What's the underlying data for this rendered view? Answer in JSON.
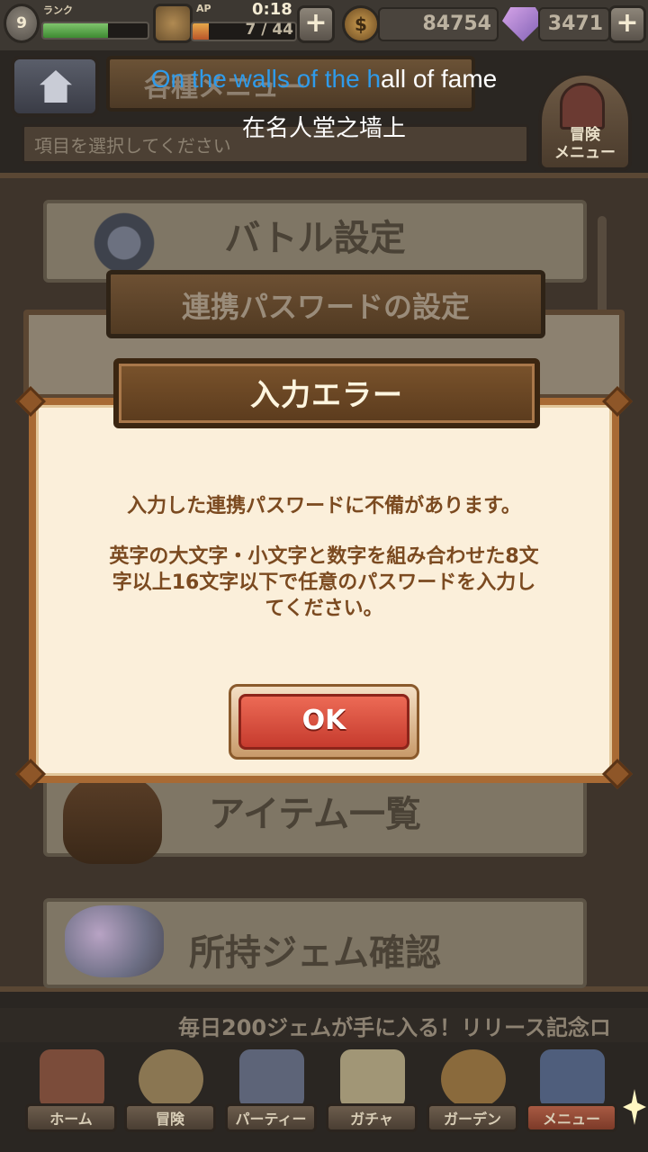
{
  "status_bar": {
    "rank_level": "9",
    "rank_label": "ランク",
    "rank_progress": 0.62,
    "ap_label": "AP",
    "ap_timer": "0:18",
    "ap_value": "7 / 44",
    "ap_progress": 0.16,
    "coins": "84754",
    "gems": "3471",
    "plus_symbol": "+"
  },
  "menu_header": {
    "title": "各種メニュー",
    "subtitle": "項目を選択してください",
    "adventure_menu_label": "冒険\nメニュー"
  },
  "menu_list": {
    "items": [
      {
        "label": "バトル設定"
      },
      {
        "label": "アイテム一覧"
      },
      {
        "label": "所持ジェム確認"
      }
    ]
  },
  "link_password_dialog": {
    "title": "連携パスワードの設定"
  },
  "error_dialog": {
    "title": "入力エラー",
    "message_line1": "入力した連携パスワードに不備があります。",
    "message_line2": "英字の大文字・小文字と数字を組み合わせた8文",
    "message_line3": "字以上16文字以下で任意のパスワードを入力し",
    "message_line4": "てください。",
    "ok_label": "OK"
  },
  "subtitles": {
    "english_highlighted": "On the walls of the h",
    "english_rest": "all of fame",
    "chinese": "在名人堂之墙上"
  },
  "ticker": {
    "text": "毎日200ジェムが手に入る！リリース記念ロ"
  },
  "bottom_nav": {
    "items": [
      {
        "label": "ホーム"
      },
      {
        "label": "冒険"
      },
      {
        "label": "パーティー"
      },
      {
        "label": "ガチャ"
      },
      {
        "label": "ガーデン"
      },
      {
        "label": "メニュー"
      }
    ]
  },
  "colors": {
    "dialog_bg": "#fbefda",
    "dialog_border": "#a86a34",
    "dialog_text": "#7b4a20",
    "ok_button": "#d9483a",
    "subtitle_highlight": "#2f9bea"
  }
}
